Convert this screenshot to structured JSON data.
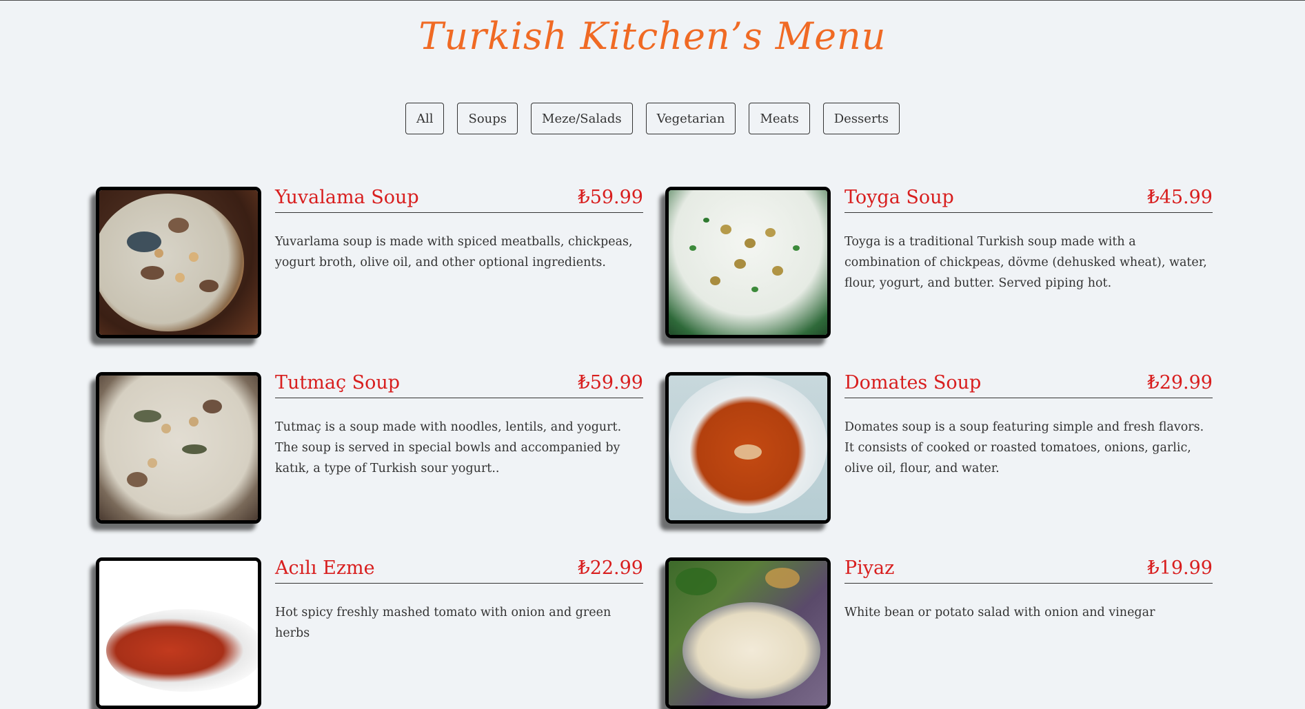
{
  "title": "Turkish Kitchen’s Menu",
  "filters": [
    "All",
    "Soups",
    "Meze/Salads",
    "Vegetarian",
    "Meats",
    "Desserts"
  ],
  "items": [
    {
      "name": "Yuvalama Soup",
      "price": "₺59.99",
      "desc": "Yuvarlama soup is made with spiced meatballs, chickpeas, yogurt broth, olive oil, and other optional ingredients.",
      "image": "yuvalama-soup-photo"
    },
    {
      "name": "Toyga Soup",
      "price": "₺45.99",
      "desc": "Toyga is a traditional Turkish soup made with a combination of chickpeas, dövme (dehusked wheat), water, flour, yogurt, and butter. Served piping hot.",
      "image": "toyga-soup-photo"
    },
    {
      "name": "Tutmaç Soup",
      "price": "₺59.99",
      "desc": "Tutmaç is a soup made with noodles, lentils, and yogurt. The soup is served in special bowls and accompanied by katık, a type of Turkish sour yogurt..",
      "image": "tutmac-soup-photo"
    },
    {
      "name": "Domates Soup",
      "price": "₺29.99",
      "desc": "Domates soup is a soup featuring simple and fresh flavors. It consists of cooked or roasted tomatoes, onions, garlic, olive oil, flour, and water.",
      "image": "domates-soup-photo"
    },
    {
      "name": "Acılı Ezme",
      "price": "₺22.99",
      "desc": "Hot spicy freshly mashed tomato with onion and green herbs",
      "image": "acili-ezme-photo"
    },
    {
      "name": "Piyaz",
      "price": "₺19.99",
      "desc": "White bean or potato salad with onion and vinegar",
      "image": "piyaz-photo"
    }
  ],
  "colors": {
    "background": "#f0f3f6",
    "title": "#f06a24",
    "item_text": "#d81e1e"
  }
}
